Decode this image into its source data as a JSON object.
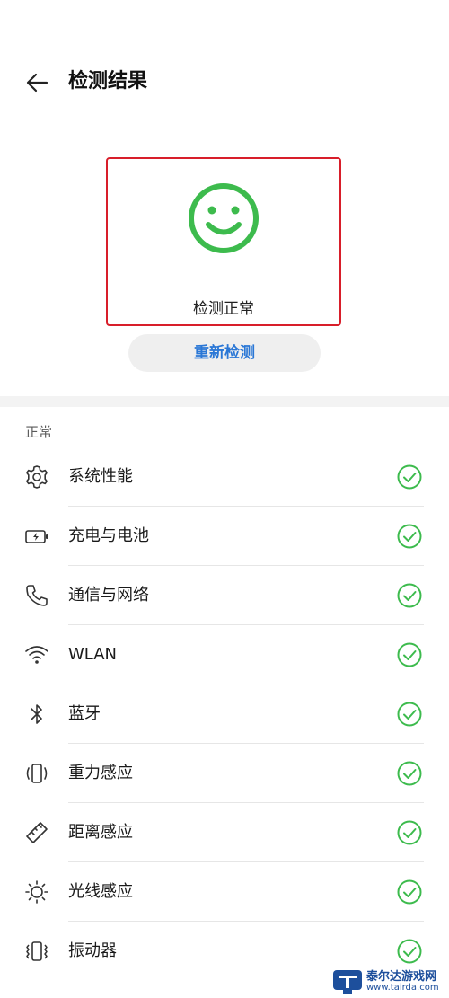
{
  "header": {
    "title": "检测结果"
  },
  "result": {
    "status_text": "检测正常",
    "icon": "smiley-icon",
    "accent": "#3dbb4d",
    "highlight_border": "#d81e2a"
  },
  "recheck_button": {
    "label": "重新检测",
    "color": "#2a77d6"
  },
  "section": {
    "title": "正常"
  },
  "items": [
    {
      "label": "系统性能",
      "icon": "gear-icon",
      "status": "ok"
    },
    {
      "label": "充电与电池",
      "icon": "battery-icon",
      "status": "ok"
    },
    {
      "label": "通信与网络",
      "icon": "phone-icon",
      "status": "ok"
    },
    {
      "label": "WLAN",
      "icon": "wifi-icon",
      "status": "ok"
    },
    {
      "label": "蓝牙",
      "icon": "bluetooth-icon",
      "status": "ok"
    },
    {
      "label": "重力感应",
      "icon": "gravity-sensor-icon",
      "status": "ok"
    },
    {
      "label": "距离感应",
      "icon": "ruler-icon",
      "status": "ok"
    },
    {
      "label": "光线感应",
      "icon": "sun-icon",
      "status": "ok"
    },
    {
      "label": "振动器",
      "icon": "vibrate-icon",
      "status": "ok"
    }
  ],
  "watermark": {
    "name": "泰尔达游戏网",
    "url": "www.tairda.com"
  }
}
